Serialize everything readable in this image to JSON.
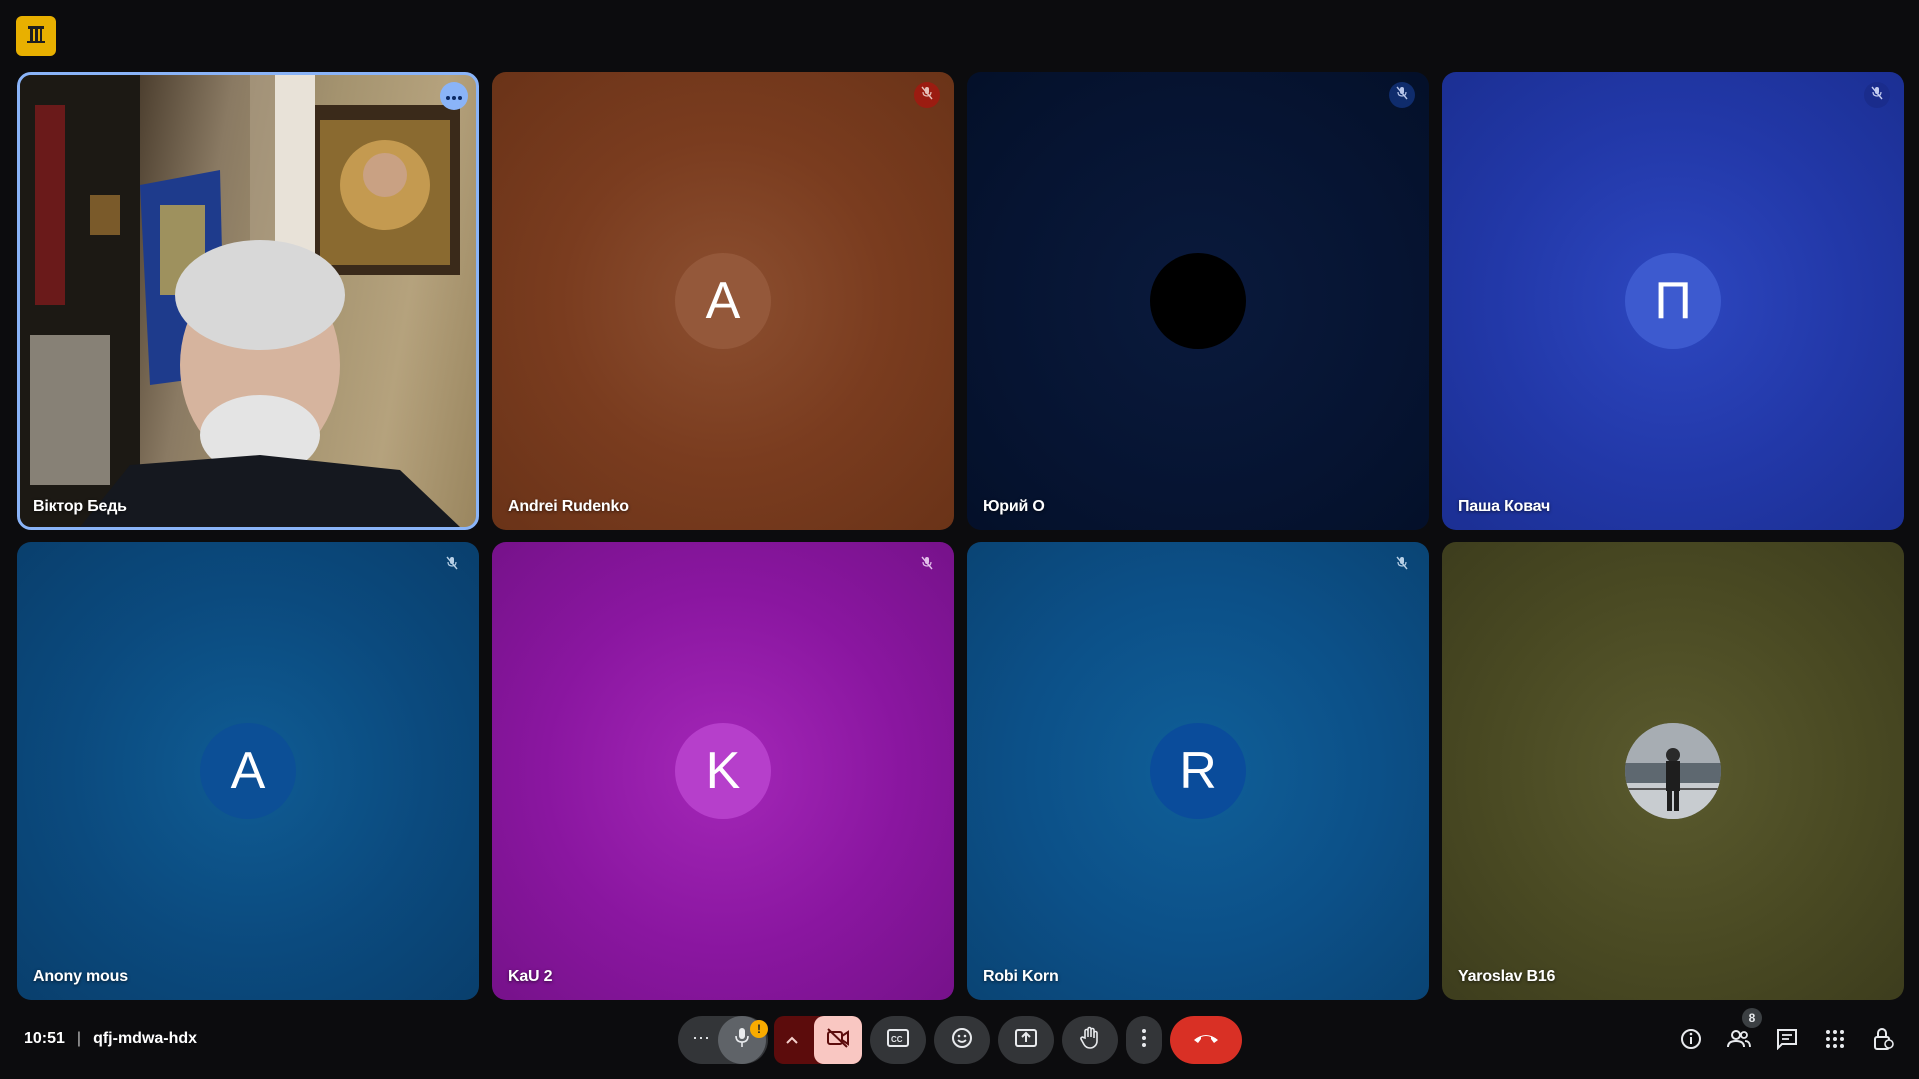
{
  "app": {
    "logo_icon": "building-icon",
    "accent": "#e8b000"
  },
  "participants": [
    {
      "name": "Віктор Бедь",
      "type": "video",
      "active": true,
      "bg": "#6b5a45"
    },
    {
      "name": "Andrei Rudenko",
      "initial": "A",
      "type": "avatar",
      "muted": true,
      "muted_color": "#a11e12",
      "bg": "#7a3f20",
      "avatar_bg": "#8e5a3f"
    },
    {
      "name": "Юрий О",
      "initial": "",
      "type": "avatar",
      "muted": true,
      "muted_color": "#0d2d6d",
      "bg": "#061330",
      "avatar_bg": "#000000"
    },
    {
      "name": "Паша Ковач",
      "initial": "П",
      "type": "avatar",
      "muted": true,
      "muted_color": "#1c3094",
      "bg": "#2236a6",
      "avatar_bg": "#3b57cf"
    },
    {
      "name": "Anony mous",
      "initial": "A",
      "type": "avatar",
      "muted": true,
      "muted_color": "#0b4c86",
      "bg": "#0c4a80",
      "avatar_bg": "#0d57a0"
    },
    {
      "name": "KaU 2",
      "initial": "K",
      "type": "avatar",
      "muted": true,
      "muted_color": "#7a1290",
      "bg": "#8a1aa0",
      "avatar_bg": "#b03bc9"
    },
    {
      "name": "Robi Korn",
      "initial": "R",
      "type": "avatar",
      "muted": true,
      "muted_color": "#0b4e88",
      "bg": "#0d508e",
      "avatar_bg": "#0a4f9a"
    },
    {
      "name": "Yaroslav B16",
      "type": "photo",
      "bg": "#4a4a22"
    }
  ],
  "meeting": {
    "time": "10:51",
    "separator": "|",
    "code": "qfj-mdwa-hdx"
  },
  "controls": {
    "more_options_label": "⋯",
    "mic_warning": "!",
    "people_count": "8"
  },
  "colors": {
    "end_call": "#d93025",
    "camera_off_bg": "#f9c7c2",
    "mic_chevron_bg": "#5c0c0c"
  }
}
